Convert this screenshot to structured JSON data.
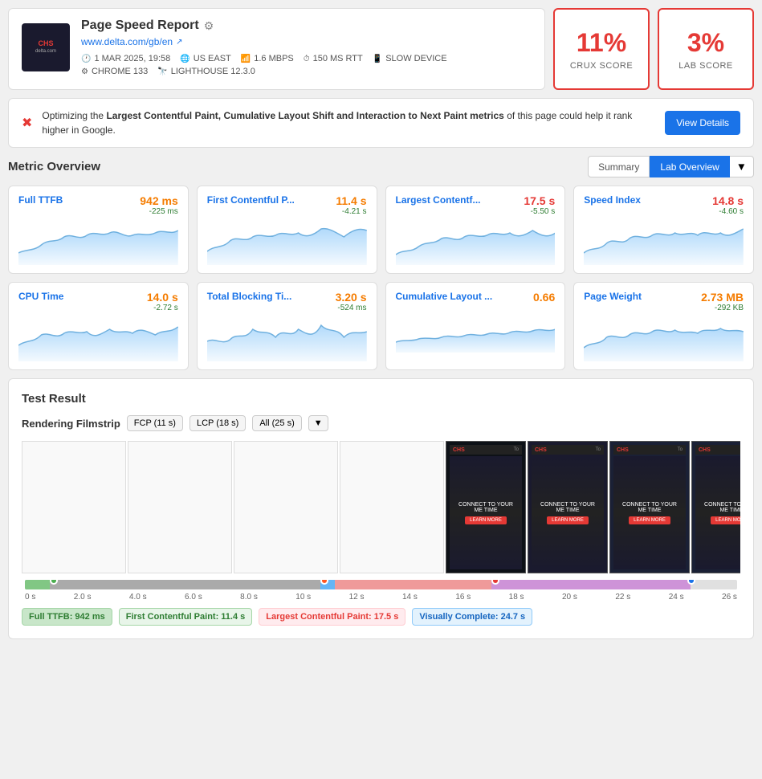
{
  "header": {
    "title": "Page Speed Report",
    "url": "www.delta.com/gb/en",
    "date": "1 MAR 2025, 19:58",
    "location": "US EAST",
    "bandwidth": "1.6 MBPS",
    "rtt": "150 MS RTT",
    "device": "SLOW DEVICE",
    "browser": "CHROME 133",
    "lighthouse": "LIGHTHOUSE 12.3.0"
  },
  "scores": {
    "crux": {
      "value": "11%",
      "label": "CRUX SCORE"
    },
    "lab": {
      "value": "3%",
      "label": "LAB SCORE"
    }
  },
  "alert": {
    "text_prefix": "Optimizing the ",
    "bold_text": "Largest Contentful Paint, Cumulative Layout Shift and Interaction to Next Paint metrics",
    "text_suffix": " of this page could help it rank higher in Google.",
    "button": "View Details"
  },
  "metric_overview": {
    "title": "Metric Overview",
    "toggle": {
      "summary": "Summary",
      "lab": "Lab Overview"
    }
  },
  "metrics": [
    {
      "name": "Full TTFB",
      "value": "942 ms",
      "delta": "-225 ms",
      "value_class": "orange"
    },
    {
      "name": "First Contentful P...",
      "value": "11.4 s",
      "delta": "-4.21 s",
      "value_class": "orange"
    },
    {
      "name": "Largest Contentf...",
      "value": "17.5 s",
      "delta": "-5.50 s",
      "value_class": "red"
    },
    {
      "name": "Speed Index",
      "value": "14.8 s",
      "delta": "-4.60 s",
      "value_class": "red"
    },
    {
      "name": "CPU Time",
      "value": "14.0 s",
      "delta": "-2.72 s",
      "value_class": "orange"
    },
    {
      "name": "Total Blocking Ti...",
      "value": "3.20 s",
      "delta": "-524 ms",
      "value_class": "orange"
    },
    {
      "name": "Cumulative Layout ...",
      "value": "0.66",
      "delta": "",
      "value_class": "orange"
    },
    {
      "name": "Page Weight",
      "value": "2.73 MB",
      "delta": "-292 KB",
      "value_class": "orange"
    }
  ],
  "test_result": {
    "title": "Test Result",
    "filmstrip_title": "Rendering Filmstrip",
    "fcp_btn": "FCP (11 s)",
    "lcp_btn": "LCP (18 s)",
    "all_btn": "All (25 s)"
  },
  "milestones": [
    {
      "label": "Full TTFB: 942 ms",
      "class": "milestone-ttfb"
    },
    {
      "label": "First Contentful Paint: 11.4 s",
      "class": "milestone-fcp"
    },
    {
      "label": "Largest Contentful Paint: 17.5 s",
      "class": "milestone-lcp"
    },
    {
      "label": "Visually Complete: 24.7 s",
      "class": "milestone-vc"
    }
  ],
  "timeline_labels": [
    "0 s",
    "2.0 s",
    "4.0 s",
    "6.0 s",
    "8.0 s",
    "10 s",
    "12 s",
    "14 s",
    "16 s",
    "18 s",
    "20 s",
    "22 s",
    "24 s",
    "26 s"
  ]
}
